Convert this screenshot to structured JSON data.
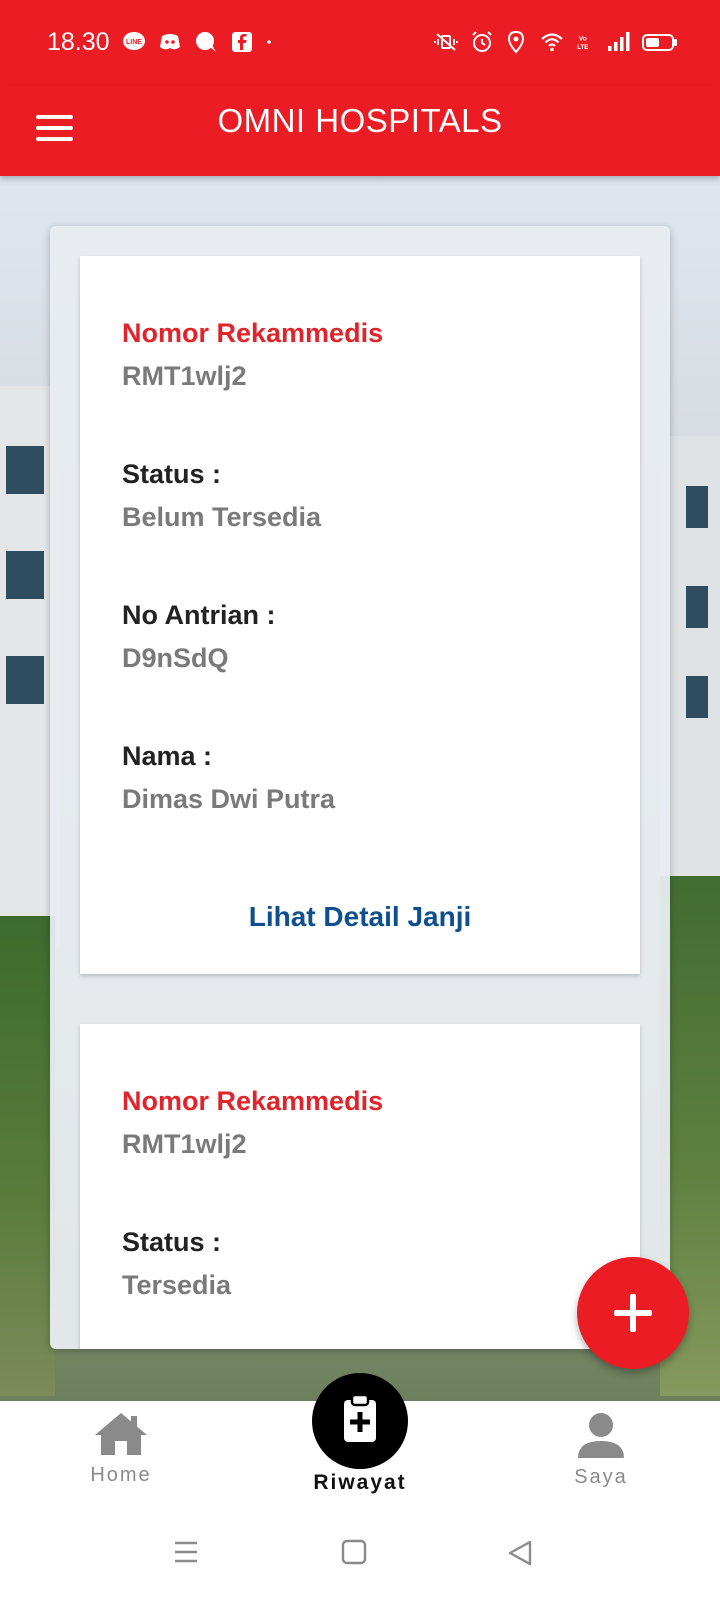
{
  "status_bar": {
    "time": "18.30",
    "left_icons": [
      "line-icon",
      "discord-icon",
      "chat-bubble-icon",
      "facebook-icon",
      "dot-icon"
    ],
    "right_icons": [
      "mute-vibrate-icon",
      "alarm-icon",
      "location-icon",
      "wifi-icon",
      "volte-icon",
      "signal-icon",
      "battery-icon"
    ]
  },
  "app_bar": {
    "title": "OMNI HOSPITALS"
  },
  "cards": [
    {
      "rekam_label": "Nomor Rekammedis",
      "rekam_value": "RMT1wlj2",
      "status_label": "Status :",
      "status_value": "Belum Tersedia",
      "antrian_label": "No Antrian :",
      "antrian_value": "D9nSdQ",
      "nama_label": "Nama :",
      "nama_value": "Dimas Dwi Putra",
      "link": "Lihat Detail Janji"
    },
    {
      "rekam_label": "Nomor Rekammedis",
      "rekam_value": "RMT1wlj2",
      "status_label": "Status :",
      "status_value": "Tersedia"
    }
  ],
  "bottom_nav": {
    "home": "Home",
    "riwayat": "Riwayat",
    "saya": "Saya"
  },
  "colors": {
    "brand_red": "#ec1c24",
    "link_blue": "#0e4f8f"
  }
}
